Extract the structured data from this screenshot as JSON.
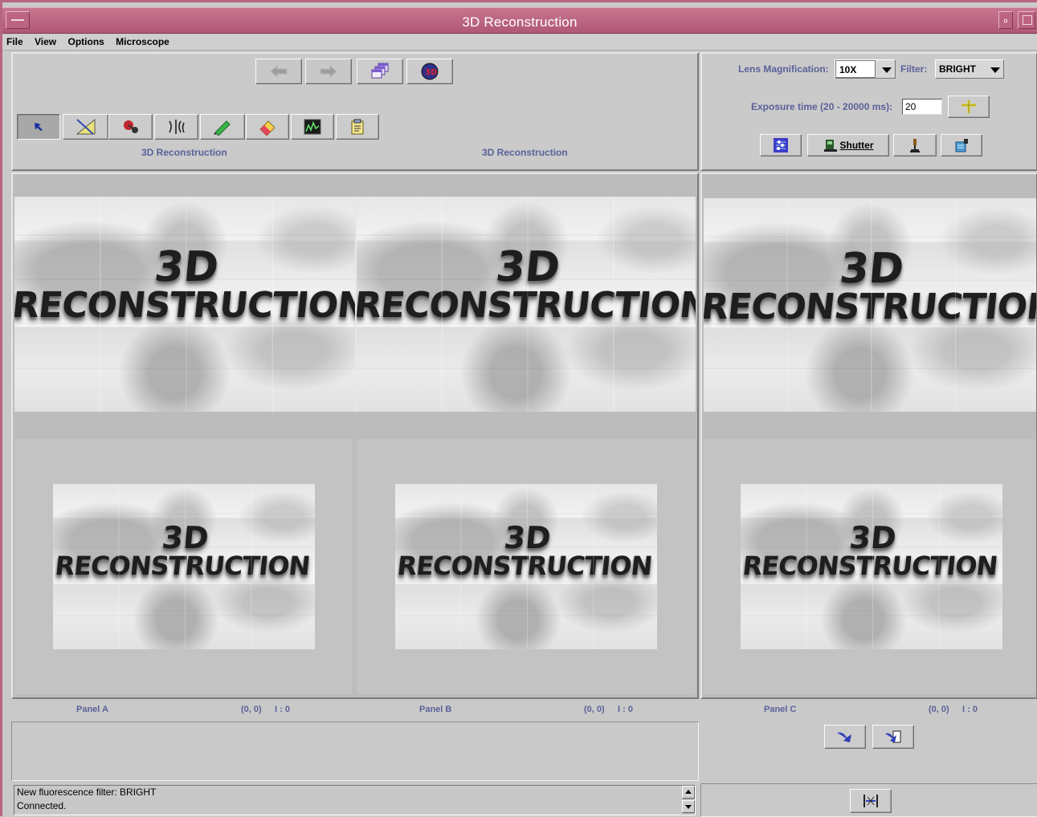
{
  "window": {
    "title": "3D Reconstruction"
  },
  "menu": {
    "items": [
      "File",
      "View",
      "Options",
      "Microscope"
    ]
  },
  "toolbar": {
    "nav_buttons": [
      {
        "icon": "arrow-left-icon",
        "enabled": false
      },
      {
        "icon": "arrow-right-icon",
        "enabled": false
      },
      {
        "icon": "windows-stack-icon",
        "enabled": true
      },
      {
        "icon": "3d-sphere-icon",
        "enabled": true
      }
    ],
    "tool_buttons": [
      {
        "icon": "pointer-arrow-icon",
        "pressed": true
      },
      {
        "icon": "ruler-angle-icon"
      },
      {
        "icon": "pin-marker-icon"
      },
      {
        "icon": "split-tool-icon"
      },
      {
        "icon": "green-pen-icon"
      },
      {
        "icon": "eraser-icon"
      },
      {
        "icon": "histogram-icon"
      },
      {
        "icon": "clipboard-icon"
      }
    ],
    "panel_titles": [
      "3D Reconstruction",
      "3D Reconstruction"
    ]
  },
  "microscope": {
    "lens_label": "Lens Magnification:",
    "lens_value": "10X",
    "filter_label": "Filter:",
    "filter_value": "BRIGHT",
    "exposure_label": "Exposure time (20 - 20000 ms):",
    "exposure_value": "20",
    "shutter_label": "Shutter"
  },
  "viewer": {
    "image_text_line1": "3D",
    "image_text_line2": "RECONSTRUCTION"
  },
  "panels": [
    {
      "name": "Panel A",
      "coords": "(0, 0)",
      "index": "I : 0"
    },
    {
      "name": "Panel B",
      "coords": "(0, 0)",
      "index": "I : 0"
    },
    {
      "name": "Panel C",
      "coords": "(0, 0)",
      "index": "I : 0"
    }
  ],
  "log": {
    "line1": "New fluorescence filter: BRIGHT",
    "line2": "Connected."
  },
  "colors": {
    "titlebar": "#b8657f",
    "label": "#5a6199",
    "background": "#c9c9c9"
  }
}
